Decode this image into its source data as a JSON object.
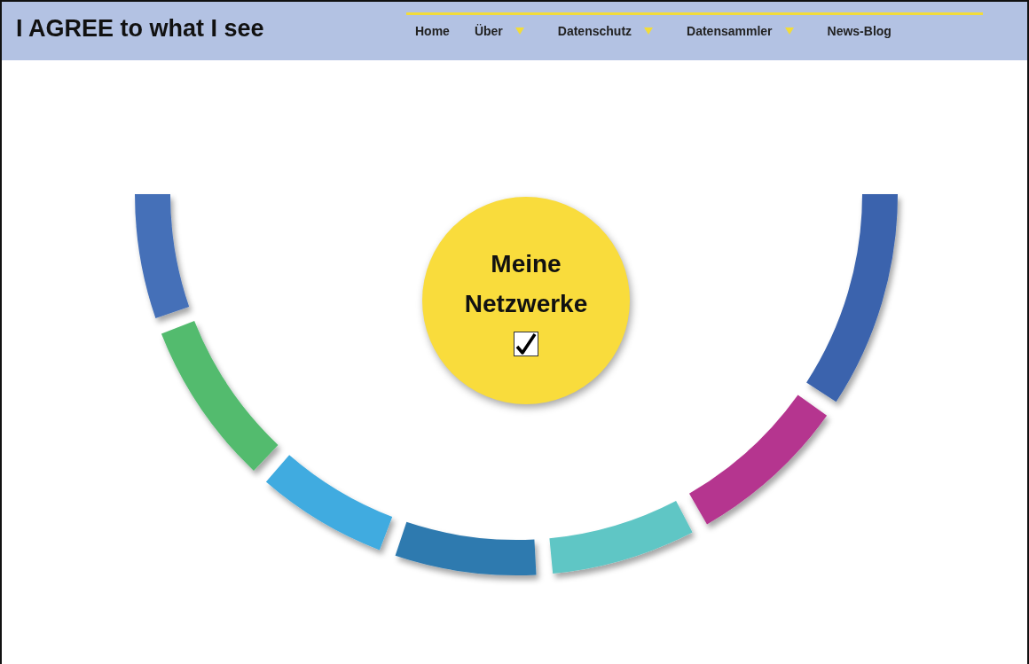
{
  "header": {
    "title": "I AGREE to what I see",
    "nav": [
      {
        "label": "Home",
        "dropdown": false
      },
      {
        "label": "Über",
        "dropdown": true
      },
      {
        "label": "Datenschutz",
        "dropdown": true
      },
      {
        "label": "Datensammler",
        "dropdown": true
      },
      {
        "label": "News-Blog",
        "dropdown": false
      }
    ]
  },
  "center": {
    "title": "Meine Netzwerke",
    "checked": true
  },
  "segments": [
    {
      "color": "#3a63ad"
    },
    {
      "color": "#b5348f"
    },
    {
      "color": "#5fc6c5"
    },
    {
      "color": "#2f7aaf"
    },
    {
      "color": "#41abe0"
    },
    {
      "color": "#52bb6e"
    },
    {
      "color": "#4570b8"
    }
  ]
}
